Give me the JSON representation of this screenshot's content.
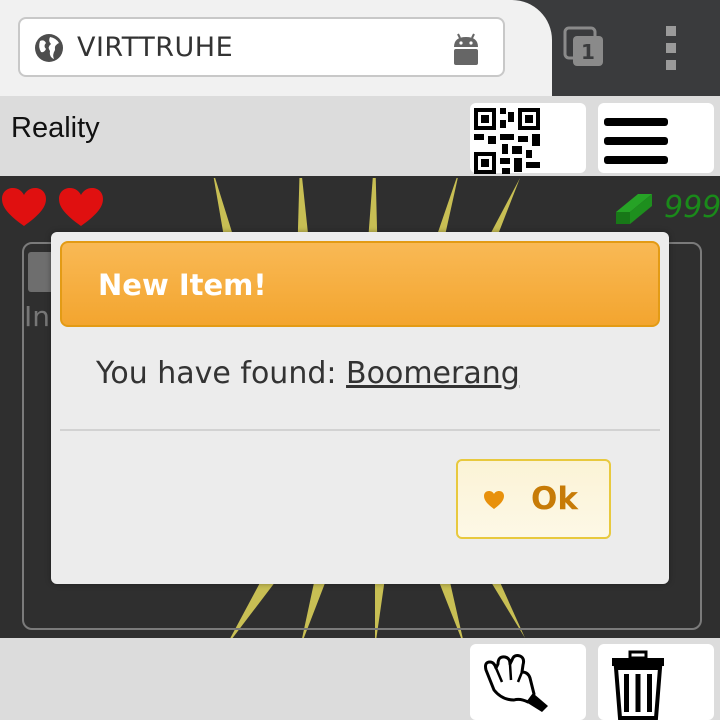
{
  "browser": {
    "url": "VIRTTRUHE",
    "tab_count": "1"
  },
  "header": {
    "title": "Reality"
  },
  "status": {
    "hearts": 2,
    "money": "999"
  },
  "inventory": {
    "label": "In"
  },
  "dialog": {
    "title": "New Item!",
    "message_prefix": "You have found: ",
    "item_name": "Boomerang",
    "ok_label": "Ok"
  },
  "colors": {
    "dialog_header": "#f5a938",
    "ok_text": "#c77b07",
    "heart": "#e01010",
    "money": "#1a8a1a"
  }
}
